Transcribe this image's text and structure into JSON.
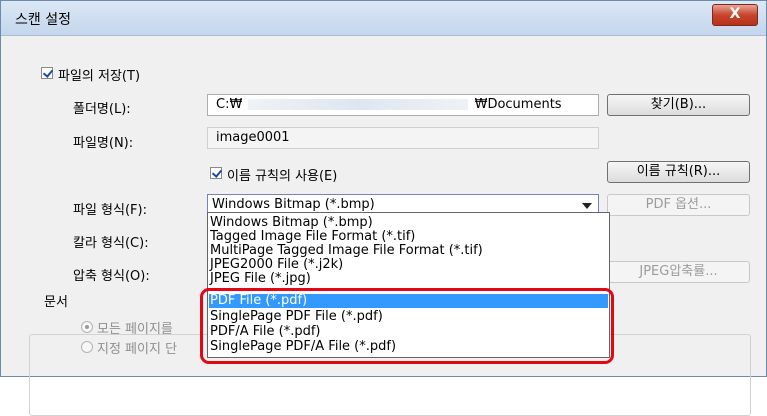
{
  "window": {
    "title": "스캔 설정",
    "close_label": "X"
  },
  "save_file": {
    "checkbox_label": "파일의 저장(T)",
    "checked": true
  },
  "folder": {
    "label": "폴더명(L):",
    "value_prefix": "C:₩",
    "value_suffix": "₩Documents",
    "browse_label": "찾기(B)..."
  },
  "file_name": {
    "label": "파일명(N):",
    "value": "image0001"
  },
  "naming_rule": {
    "checkbox_label": "이름 규칙의 사용(E)",
    "checked": true,
    "button_label": "이름 규칙(R)..."
  },
  "file_format": {
    "label": "파일 형식(F):",
    "selected": "Windows Bitmap (*.bmp)",
    "pdf_options_label": "PDF 옵션...",
    "options": [
      "Windows Bitmap (*.bmp)",
      "Tagged Image File Format (*.tif)",
      "MultiPage Tagged Image File Format (*.tif)",
      "JPEG2000 File (*.j2k)",
      "JPEG File (*.jpg)",
      "PDF File (*.pdf)",
      "SinglePage PDF File (*.pdf)",
      "PDF/A File (*.pdf)",
      "SinglePage PDF/A File (*.pdf)"
    ],
    "highlighted_option_index": 5
  },
  "color_format": {
    "label": "칼라 형식(C):"
  },
  "compression": {
    "label": "압축 형식(O):",
    "jpeg_button_label": "JPEG압축률..."
  },
  "document": {
    "group_label": "문서",
    "all_pages_label": "모든 페이지를",
    "specified_pages_label": "지정 페이지 단"
  }
}
